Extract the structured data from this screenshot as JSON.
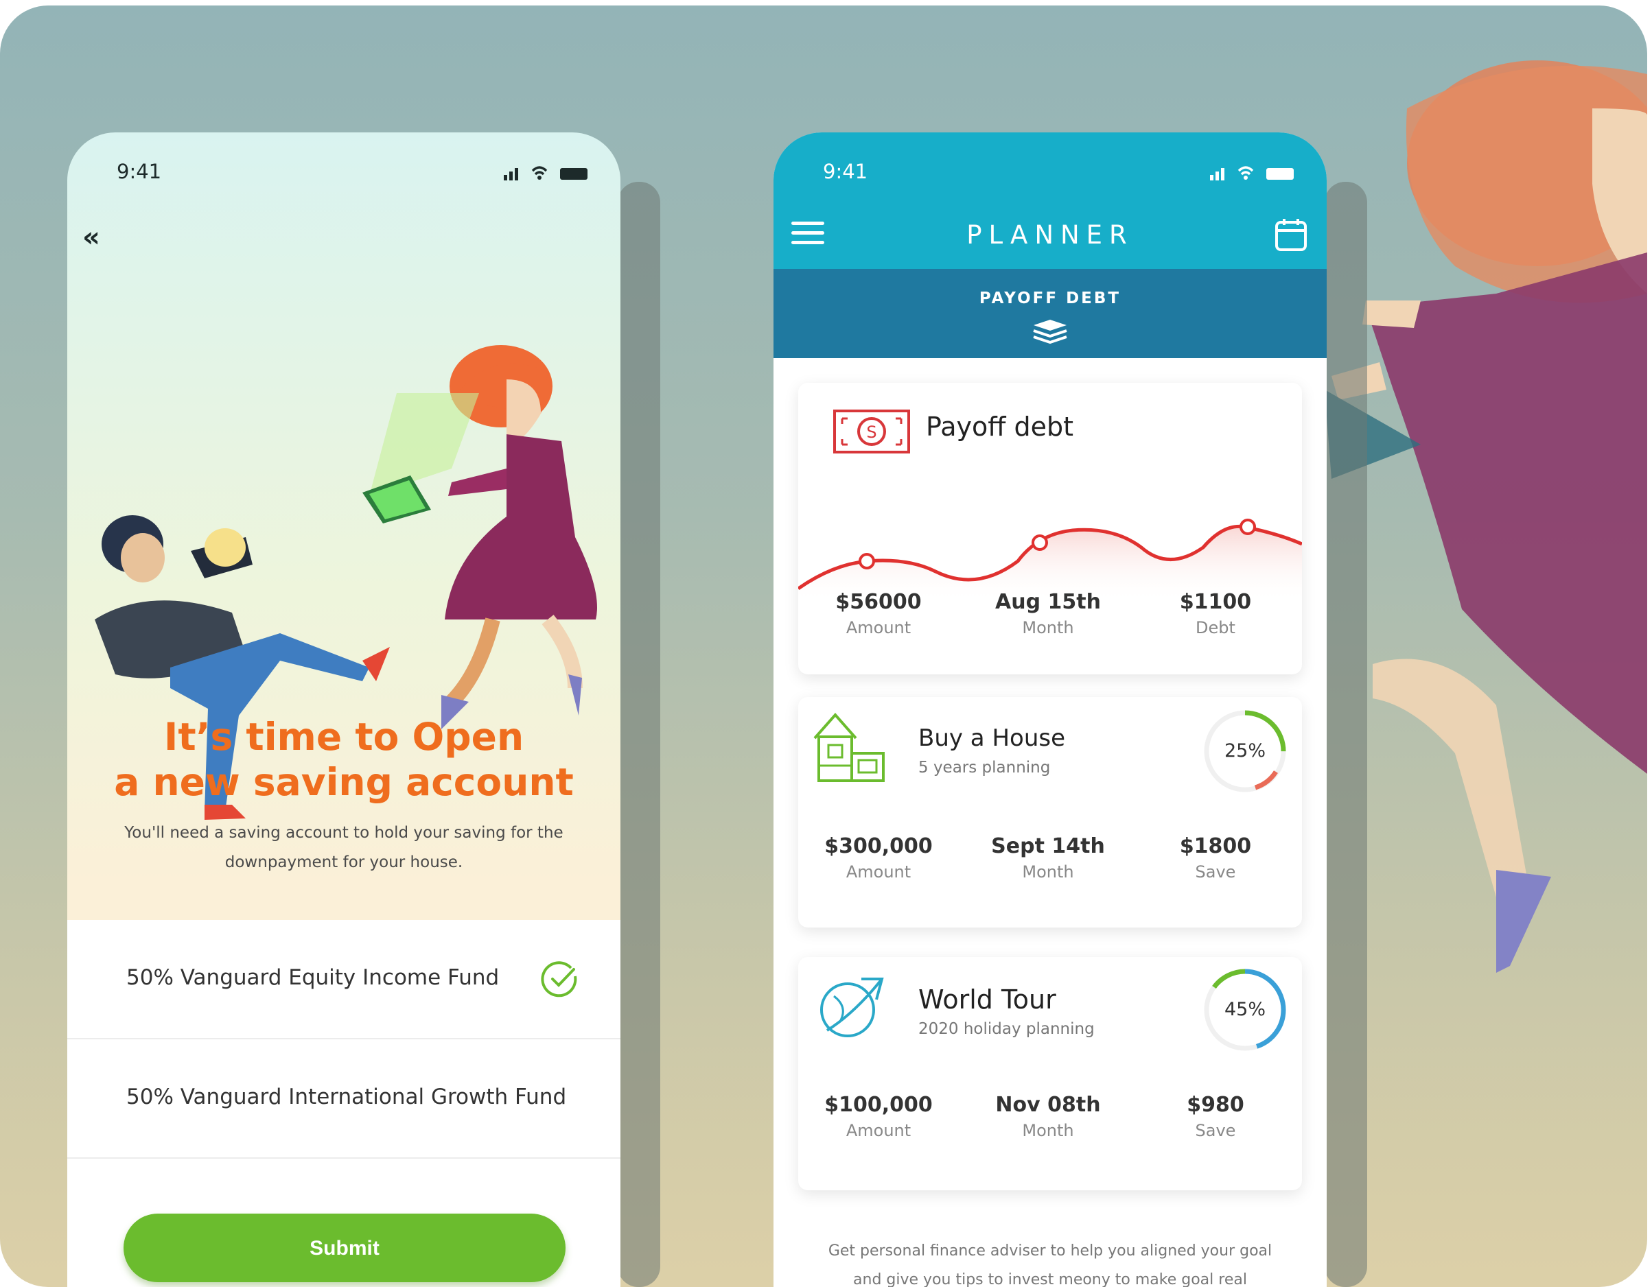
{
  "left_phone": {
    "status_time": "9:41",
    "hero_title_line1": "It’s time to Open",
    "hero_title_line2": "a new saving account",
    "hero_desc": "You'll need a saving account to hold your saving for the downpayment for your house.",
    "funds": [
      {
        "label": "50% Vanguard Equity Income Fund",
        "selected": true
      },
      {
        "label": "50% Vanguard International Growth Fund",
        "selected": false
      }
    ],
    "submit_label": "Submit"
  },
  "right_phone": {
    "status_time": "9:41",
    "title": "PLANNER",
    "sub_title": "PAYOFF DEBT",
    "cards": [
      {
        "title": "Payoff debt",
        "stats": [
          {
            "value": "$56000",
            "label": "Amount"
          },
          {
            "value": "Aug 15th",
            "label": "Month"
          },
          {
            "value": "$1100",
            "label": "Debt"
          }
        ]
      },
      {
        "title": "Buy a House",
        "subtitle": "5 years planning",
        "progress": "25%",
        "progress_value": 0.25,
        "stats": [
          {
            "value": "$300,000",
            "label": "Amount"
          },
          {
            "value": "Sept 14th",
            "label": "Month"
          },
          {
            "value": "$1800",
            "label": "Save"
          }
        ]
      },
      {
        "title": "World Tour",
        "subtitle": "2020 holiday planning",
        "progress": "45%",
        "progress_value": 0.45,
        "stats": [
          {
            "value": "$100,000",
            "label": "Amount"
          },
          {
            "value": "Nov 08th",
            "label": "Month"
          },
          {
            "value": "$980",
            "label": "Save"
          }
        ]
      }
    ],
    "footer_text": "Get personal finance adviser to help you aligned your goal and give you tips to invest meony to make goal real"
  },
  "colors": {
    "accent_orange": "#ef6d1e",
    "accent_green": "#6bbc2e",
    "header_teal": "#17aec9",
    "subheader_blue": "#1f79a0",
    "chart_red": "#e0312f"
  }
}
